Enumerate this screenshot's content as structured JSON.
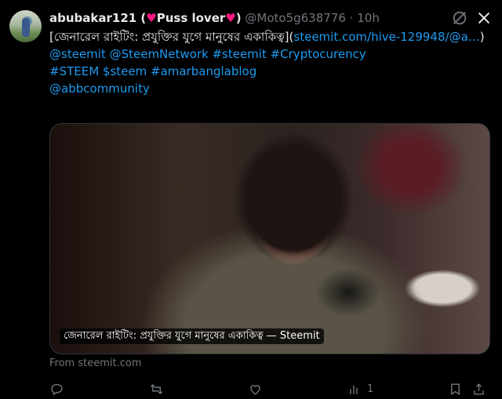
{
  "tweet": {
    "display_name": "abubakar121 (",
    "name_badge": "Puss lover",
    "name_close": ")",
    "handle": "@Moto5g638776",
    "separator": "·",
    "time": "10h",
    "text_prefix": "[জেনারেল রাইটিং: প্রযুক্তির যুগে মানুষের একাকিত্ব](",
    "link": "steemit.com/hive-129948/@a…",
    "text_close": ")",
    "mentions_line1": "@steemit @SteemNetwork #steemit #Cryptocurency",
    "mentions_line2": "#STEEM $steem #amarbanglablog",
    "mentions_line3": "@abbcommunity"
  },
  "card": {
    "label": "জেনারেল রাইটিং: প্রযুক্তির যুগে মানুষের একাকিত্ব — Steemit",
    "source": "From steemit.com"
  },
  "actions": {
    "views_count": "1"
  },
  "icons": [
    "grok-icon",
    "x-logo-icon",
    "reply-icon",
    "retweet-icon",
    "like-icon",
    "views-icon",
    "bookmark-icon",
    "share-icon"
  ],
  "colors": {
    "link": "#1d9bf0",
    "heart": "#f91880",
    "muted": "#71767b",
    "background": "#000000"
  }
}
